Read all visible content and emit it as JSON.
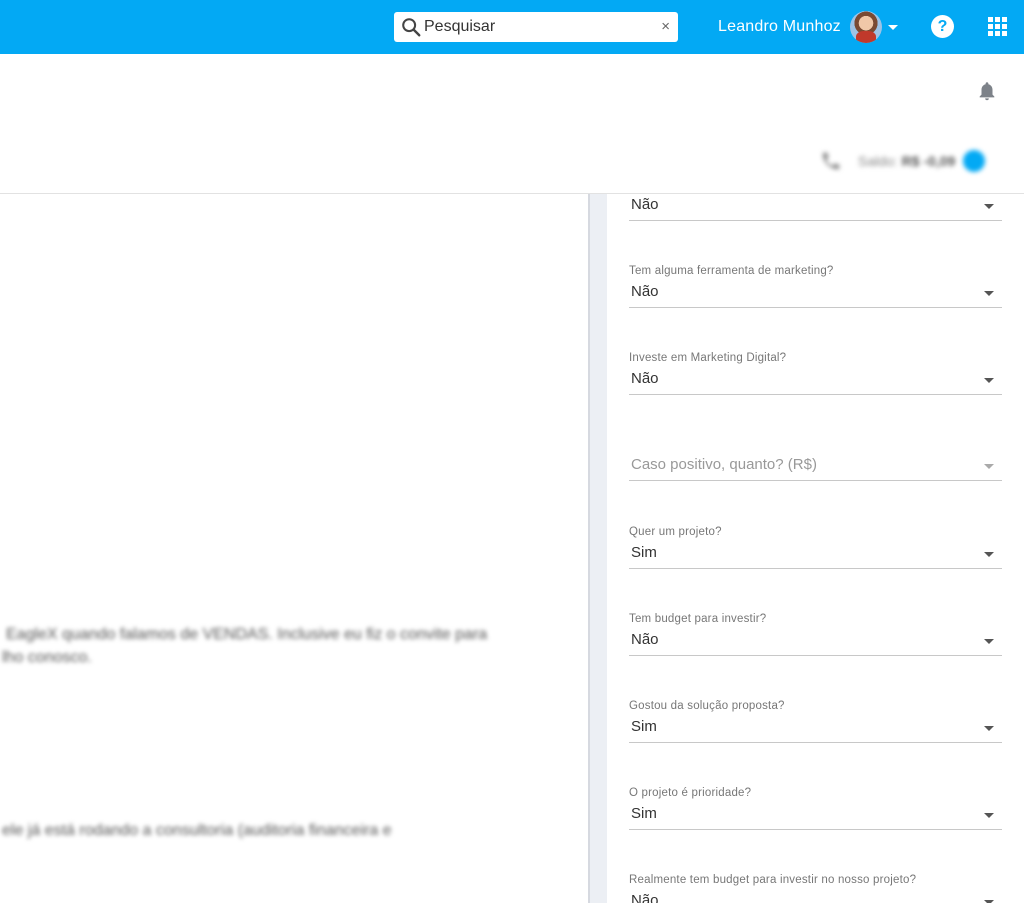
{
  "topbar": {
    "search_placeholder": "Pesquisar",
    "clear_symbol": "×",
    "user_name": "Leandro Munhoz",
    "help_symbol": "?"
  },
  "header": {
    "balance_label": "Saldo:",
    "balance_value": "R$ -0,09"
  },
  "background_text": {
    "line1": "EagleX quando falamos de VENDAS. Inclusive eu fiz o convite para",
    "line2": "lho conosco.",
    "line3": "ele já está rodando a consultoria (auditoria financeira e"
  },
  "form": {
    "fields": [
      {
        "label": "",
        "value": "Não",
        "placeholder": false
      },
      {
        "label": "Tem alguma ferramenta de marketing?",
        "value": "Não",
        "placeholder": false
      },
      {
        "label": "Investe em Marketing Digital?",
        "value": "Não",
        "placeholder": false
      },
      {
        "label": "",
        "value": "Caso positivo, quanto? (R$)",
        "placeholder": true
      },
      {
        "label": "Quer um projeto?",
        "value": "Sim",
        "placeholder": false
      },
      {
        "label": "Tem budget para investir?",
        "value": "Não",
        "placeholder": false
      },
      {
        "label": "Gostou da solução proposta?",
        "value": "Sim",
        "placeholder": false
      },
      {
        "label": "O projeto é prioridade?",
        "value": "Sim",
        "placeholder": false
      },
      {
        "label": "Realmente tem budget para investir no nosso projeto?",
        "value": "Não",
        "placeholder": false
      }
    ]
  },
  "colors": {
    "primary": "#03a9f4",
    "divider": "#eceff4"
  },
  "icons": [
    "search-icon",
    "close-icon",
    "chevron-down-icon",
    "help-icon",
    "apps-grid-icon",
    "bell-icon",
    "phone-icon"
  ]
}
